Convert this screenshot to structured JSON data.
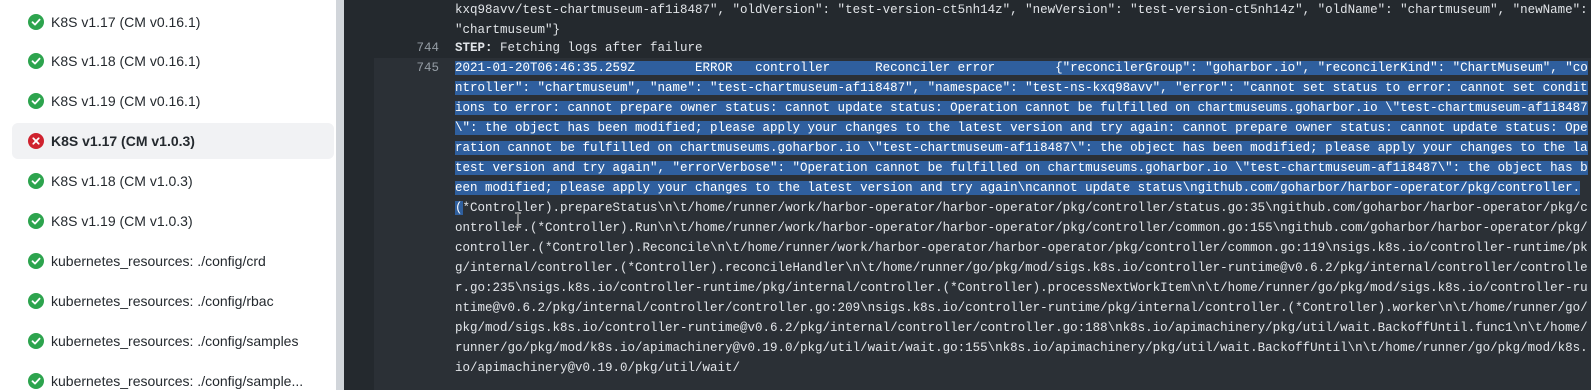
{
  "colors": {
    "success": "#2da44e",
    "failure": "#cf222e",
    "selection": "#2f5f9e",
    "log_background": "#24292e"
  },
  "jobs": [
    {
      "label": "K8S v1.17 (CM v0.16.1)",
      "status": "success",
      "icon": "check-circle-icon"
    },
    {
      "label": "K8S v1.18 (CM v0.16.1)",
      "status": "success",
      "icon": "check-circle-icon"
    },
    {
      "label": "K8S v1.19 (CM v0.16.1)",
      "status": "success",
      "icon": "check-circle-icon"
    },
    {
      "label": "K8S v1.17 (CM v1.0.3)",
      "status": "failure",
      "icon": "x-circle-icon",
      "selected": true
    },
    {
      "label": "K8S v1.18 (CM v1.0.3)",
      "status": "success",
      "icon": "check-circle-icon"
    },
    {
      "label": "K8S v1.19 (CM v1.0.3)",
      "status": "success",
      "icon": "check-circle-icon"
    },
    {
      "label": "kubernetes_resources: ./config/crd",
      "status": "success",
      "icon": "check-circle-icon"
    },
    {
      "label": "kubernetes_resources: ./config/rbac",
      "status": "success",
      "icon": "check-circle-icon"
    },
    {
      "label": "kubernetes_resources: ./config/samples",
      "status": "success",
      "icon": "check-circle-icon"
    },
    {
      "label": "kubernetes_resources: ./config/sample...",
      "status": "success",
      "icon": "check-circle-icon"
    }
  ],
  "log": {
    "top_text": "kxq98avv/test-chartmuseum-af1i8487\", \"oldVersion\": \"test-version-ct5nh14z\", \"newVersion\": \"test-version-ct5nh14z\", \"oldName\": \"chartmuseum\", \"newName\": \"chartmuseum\"}",
    "line_744_num": "744",
    "line_744_step": "STEP:",
    "line_744_text": " Fetching logs after failure",
    "line_745_num": "745",
    "line_745_selected": "2021-01-20T06:46:35.259Z\tERROR\tcontroller\tReconciler error\t{\"reconcilerGroup\": \"goharbor.io\", \"reconcilerKind\": \"ChartMuseum\", \"controller\": \"chartmuseum\", \"name\": \"test-chartmuseum-af1i8487\", \"namespace\": \"test-ns-kxq98avv\", \"error\": \"cannot set status to error: cannot set conditions to error: cannot prepare owner status: cannot update status: Operation cannot be fulfilled on chartmuseums.goharbor.io \\\"test-chartmuseum-af1i8487\\\": the object has been modified; please apply your changes to the latest version and try again: cannot prepare owner status: cannot update status: Operation cannot be fulfilled on chartmuseums.goharbor.io \\\"test-chartmuseum-af1i8487\\\": the object has been modified; please apply your changes to the latest version and try again\", \"errorVerbose\": \"Operation cannot be fulfilled on chartmuseums.goharbor.io \\\"test-chartmuseum-af1i8487\\\": the object has been modified; please apply your changes to the latest version and try again\\ncannot update status\\ngithub.com/goharbor/harbor-operator/pkg/controller.",
    "line_745_sel_tail": "(",
    "line_745_rest": "*Controller).prepareStatus\\n\\t/home/runner/work/harbor-operator/harbor-operator/pkg/controller/status.go:35\\ngithub.com/goharbor/harbor-operator/pkg/controller.(*Controller).Run\\n\\t/home/runner/work/harbor-operator/harbor-operator/pkg/controller/common.go:155\\ngithub.com/goharbor/harbor-operator/pkg/controller.(*Controller).Reconcile\\n\\t/home/runner/work/harbor-operator/harbor-operator/pkg/controller/common.go:119\\nsigs.k8s.io/controller-runtime/pkg/internal/controller.(*Controller).reconcileHandler\\n\\t/home/runner/go/pkg/mod/sigs.k8s.io/controller-runtime@v0.6.2/pkg/internal/controller/controller.go:235\\nsigs.k8s.io/controller-runtime/pkg/internal/controller.(*Controller).processNextWorkItem\\n\\t/home/runner/go/pkg/mod/sigs.k8s.io/controller-runtime@v0.6.2/pkg/internal/controller/controller.go:209\\nsigs.k8s.io/controller-runtime/pkg/internal/controller.(*Controller).worker\\n\\t/home/runner/go/pkg/mod/sigs.k8s.io/controller-runtime@v0.6.2/pkg/internal/controller/controller.go:188\\nk8s.io/apimachinery/pkg/util/wait.BackoffUntil.func1\\n\\t/home/runner/go/pkg/mod/k8s.io/apimachinery@v0.19.0/pkg/util/wait/wait.go:155\\nk8s.io/apimachinery/pkg/util/wait.BackoffUntil\\n\\t/home/runner/go/pkg/mod/k8s.io/apimachinery@v0.19.0/pkg/util/wait/"
  }
}
